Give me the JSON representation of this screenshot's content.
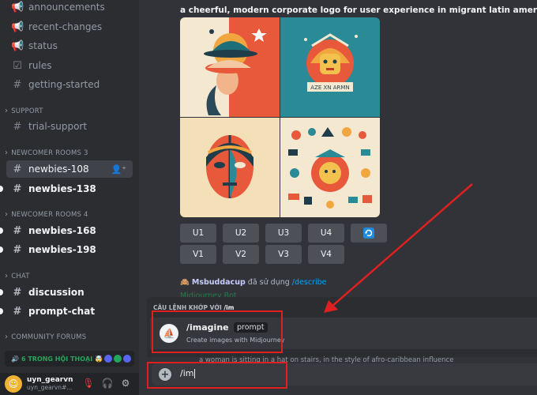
{
  "sidebar": {
    "channels_top": [
      {
        "label": "announcements",
        "icon": "megaphone-icon",
        "glyph": "📢"
      },
      {
        "label": "recent-changes",
        "icon": "megaphone-icon",
        "glyph": "📢"
      },
      {
        "label": "status",
        "icon": "megaphone-icon",
        "glyph": "📢"
      },
      {
        "label": "rules",
        "icon": "checkbox-icon",
        "glyph": "☑"
      },
      {
        "label": "getting-started",
        "icon": "hash-icon",
        "glyph": "#"
      }
    ],
    "categories": {
      "support": "SUPPORT",
      "newcomer3": "NEWCOMER ROOMS 3",
      "newcomer4": "NEWCOMER ROOMS 4",
      "chat": "CHAT",
      "forums": "COMMUNITY FORUMS"
    },
    "trial_support": "trial-support",
    "newbies_108": "newbies-108",
    "newbies_138": "newbies-138",
    "newbies_168": "newbies-168",
    "newbies_198": "newbies-198",
    "discussion": "discussion",
    "prompt_chat": "prompt-chat",
    "voice_status": "6 TRONG HỘI THOẠI",
    "user": {
      "name": "uyn_gearvn",
      "tag": "uyn_gearvn#..."
    }
  },
  "main": {
    "prompt_text": "a cheerful, modern corporate logo for user experience in migrant latin american people -",
    "logo_text": "AZE XN ARMN",
    "upscale_buttons": [
      "U1",
      "U2",
      "U3",
      "U4"
    ],
    "variation_buttons": [
      "V1",
      "V2",
      "V3",
      "V4"
    ],
    "reply": {
      "username": "Msbuddacup",
      "action": "đã sử dụng",
      "command": "/describe"
    },
    "bot_line": "Midjourney Bot",
    "autocomplete": {
      "header": "CÂU LỆNH KHỚP VỚI",
      "query": "/im",
      "command": "/imagine",
      "param": "prompt",
      "description": "Create images with Midjourney"
    },
    "peek_text": "a woman is sitting in a hat on stairs, in the style of afro-caribbean influence",
    "input_value": "/im"
  },
  "colors": {
    "accent_red": "#e02020",
    "online_green": "#23a55a",
    "blurple": "#5865f2"
  }
}
